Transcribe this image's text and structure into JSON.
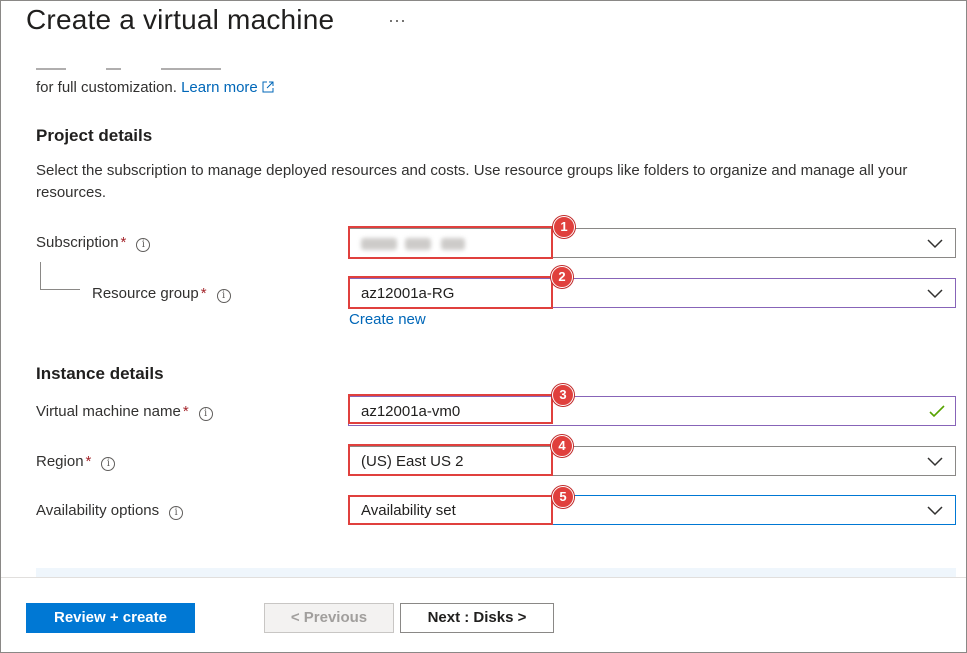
{
  "header": {
    "title": "Create a virtual machine",
    "more_label": "···"
  },
  "intro": {
    "text": "for full customization.",
    "learn_more": "Learn more"
  },
  "project": {
    "heading": "Project details",
    "description": "Select the subscription to manage deployed resources and costs. Use resource groups like folders to organize and manage all your resources.",
    "subscription_label": "Subscription",
    "resource_group_label": "Resource group",
    "resource_group_value": "az12001a-RG",
    "create_new": "Create new"
  },
  "instance": {
    "heading": "Instance details",
    "vm_name_label": "Virtual machine name",
    "vm_name_value": "az12001a-vm0",
    "region_label": "Region",
    "region_value": "(US) East US 2",
    "availability_label": "Availability options",
    "availability_value": "Availability set"
  },
  "annotations": [
    "1",
    "2",
    "3",
    "4",
    "5"
  ],
  "footer": {
    "review_create": "Review + create",
    "previous": "< Previous",
    "next": "Next : Disks >"
  },
  "colors": {
    "accent": "#0078d4",
    "annotation": "#e0403d",
    "required": "#a4262c",
    "link": "#0067b8"
  },
  "icons": [
    "more-icon",
    "external-link-icon",
    "info-icon",
    "chevron-down-icon",
    "checkmark-icon"
  ]
}
